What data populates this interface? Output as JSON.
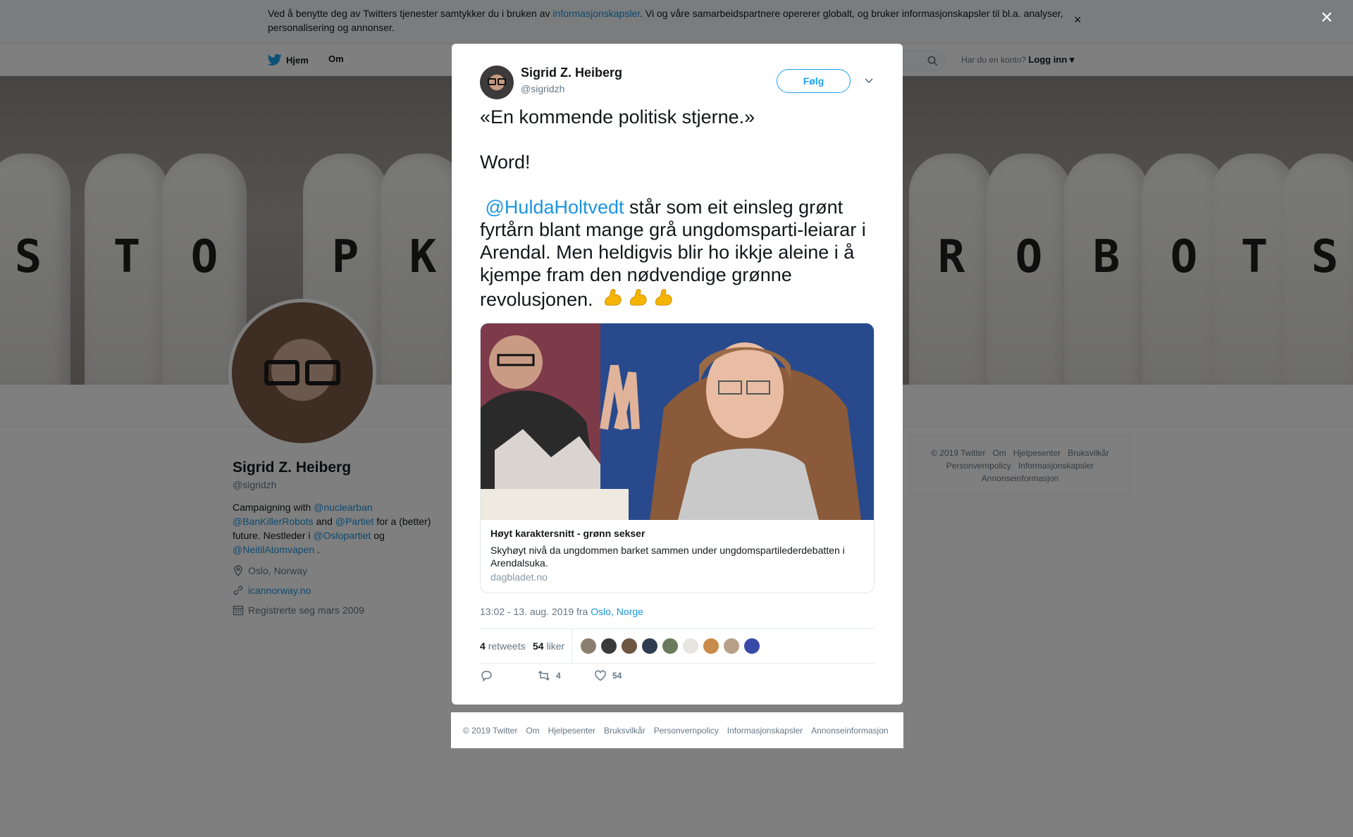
{
  "cookie_banner": {
    "text_before": "Ved å benytte deg av Twitters tjenester samtykker du i bruken av ",
    "link": "informasjonskapsler",
    "text_after": ". Vi og våre samarbeidspartnere opererer globalt, og bruker informasjonskapsler til bl.a. analyser, personalisering og annonser.",
    "close": "×"
  },
  "topnav": {
    "home": "Hjem",
    "about": "Om",
    "have_account": "Har du en konto?",
    "login": "Logg inn"
  },
  "banner": {
    "letters_left": [
      "S",
      "T",
      "O",
      "P",
      "K"
    ],
    "letters_right": [
      "R",
      "O",
      "B",
      "O",
      "T",
      "S"
    ]
  },
  "profile": {
    "name": "Sigrid Z. Heiberg",
    "handle": "@sigridzh",
    "bio": {
      "t1": "Campaigning with ",
      "m1": "@nuclearban",
      "m2": "@BanKillerRobots",
      "t2": " and ",
      "m3": "@Partiet",
      "t3": " for a (better) future. Nestleder i ",
      "m4": "@Oslopartiet",
      "t4": " og ",
      "m5": "@NeitilAtomvapen",
      "t5": " ."
    },
    "location": "Oslo, Norway",
    "website": "icannorway.no",
    "joined": "Registrerte seg mars 2009"
  },
  "right_footer": [
    "© 2019 Twitter",
    "Om",
    "Hjelpesenter",
    "Bruksvilkår",
    "Personvernpolicy",
    "Informasjonskapsler",
    "Annonseinformasjon"
  ],
  "overlay_close": "×",
  "tweet": {
    "name": "Sigrid Z. Heiberg",
    "handle": "@sigridzh",
    "follow_label": "Følg",
    "line1": "«En kommende politisk stjerne.»",
    "line2": "Word!",
    "mention": "@HuldaHoltvedt",
    "line3": " står som eit einsleg grønt fyrtårn blant mange grå ungdomsparti-leiarar i Arendal. Men heldigvis blir ho ikkje aleine i å kjempe fram den nødvendige grønne revolusjonen.",
    "card": {
      "title": "Høyt karaktersnitt - grønn sekser",
      "description": "Skyhøyt nivå da ungdommen barket sammen under ungdomspartilederdebatten i Arendalsuka.",
      "domain": "dagbladet.no"
    },
    "timestamp": "13:02 - 13. aug. 2019 fra ",
    "location": "Oslo, Norge",
    "retweets_count": "4",
    "retweets_label": "retweets",
    "likes_count": "54",
    "likes_label": "liker",
    "action_retweet_count": "4",
    "action_like_count": "54",
    "liker_colors": [
      "#8a7f6e",
      "#3a3a3a",
      "#6d5642",
      "#2f3b4f",
      "#6a7a5c",
      "#e8e4df",
      "#c98a4a",
      "#b8a088",
      "#3a49a8"
    ]
  },
  "modal_footer": [
    "© 2019 Twitter",
    "Om",
    "Hjelpesenter",
    "Bruksvilkår",
    "Personvernpolicy",
    "Informasjonskapsler",
    "Annonseinformasjon"
  ],
  "colors": {
    "accent": "#1da1f2",
    "link": "#1b95e0",
    "muted": "#657786"
  }
}
